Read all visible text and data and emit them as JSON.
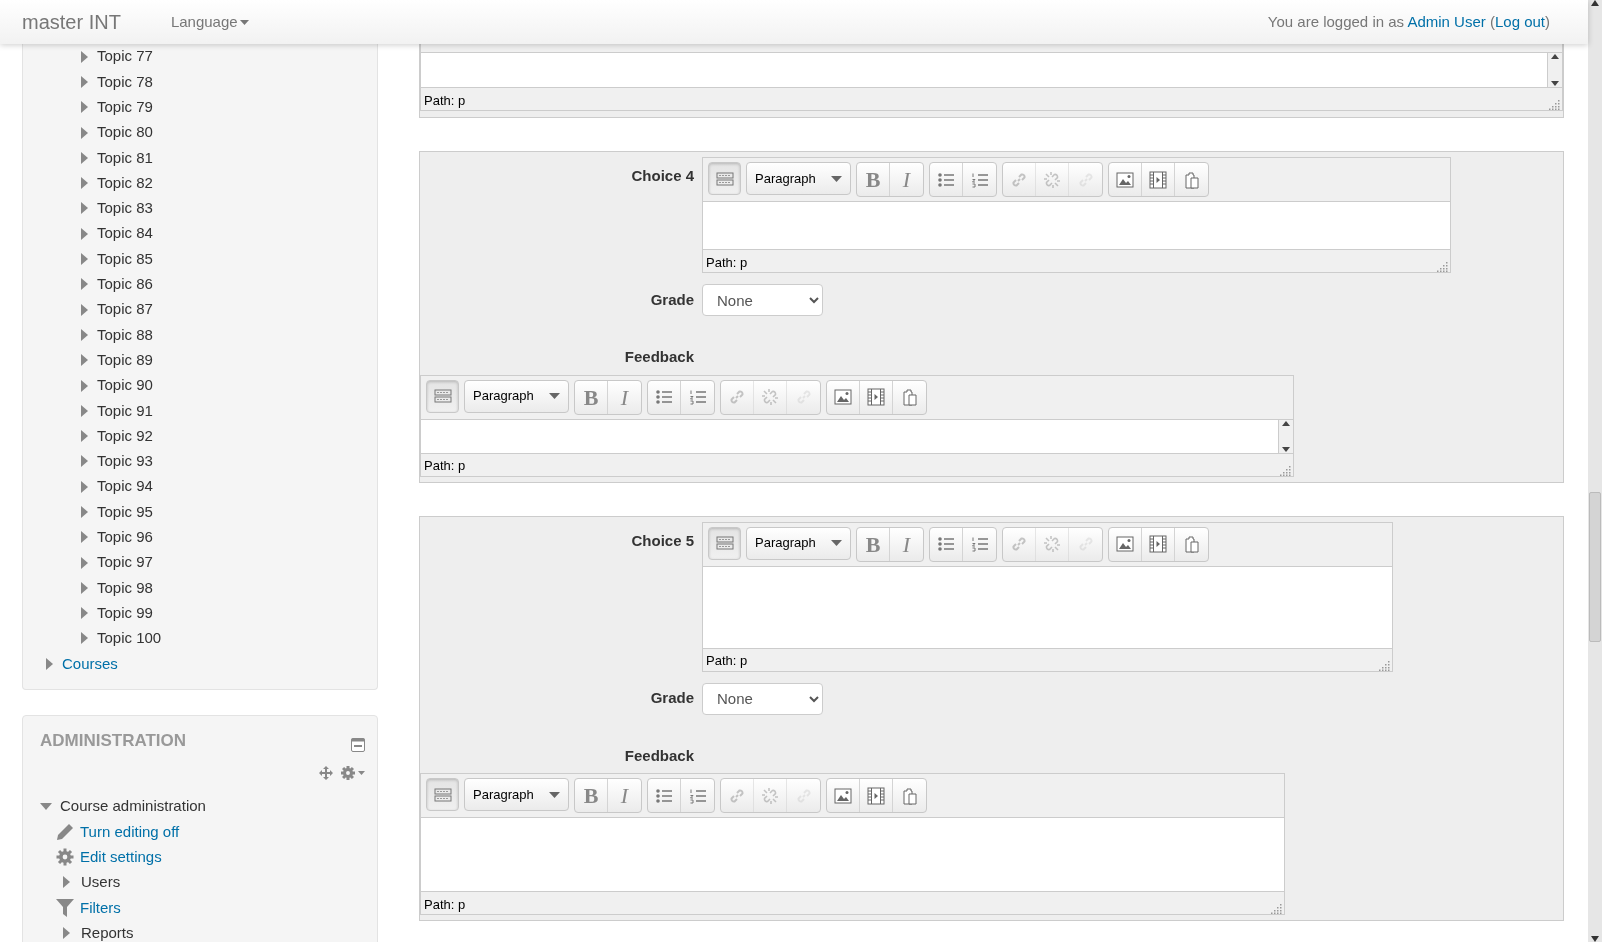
{
  "navbar": {
    "brand": "master INT",
    "language_menu": "Language",
    "login": {
      "text_before": "You are logged in as",
      "user": "Admin User",
      "text_open": "(",
      "logout": "Log out",
      "text_close": ")"
    }
  },
  "navigation": {
    "topics": [
      {
        "label": "Topic 77",
        "expanded": false
      },
      {
        "label": "Topic 78",
        "expanded": false
      },
      {
        "label": "Topic 79",
        "expanded": false
      },
      {
        "label": "Topic 80",
        "expanded": false
      },
      {
        "label": "Topic 81",
        "expanded": false
      },
      {
        "label": "Topic 82",
        "expanded": false
      },
      {
        "label": "Topic 83",
        "expanded": false
      },
      {
        "label": "Topic 84",
        "expanded": false
      },
      {
        "label": "Topic 85",
        "expanded": false
      },
      {
        "label": "Topic 86",
        "expanded": false
      },
      {
        "label": "Topic 87",
        "expanded": false
      },
      {
        "label": "Topic 88",
        "expanded": false
      },
      {
        "label": "Topic 89",
        "expanded": false
      },
      {
        "label": "Topic 90",
        "expanded": false
      },
      {
        "label": "Topic 91",
        "expanded": false
      },
      {
        "label": "Topic 92",
        "expanded": false
      },
      {
        "label": "Topic 93",
        "expanded": false
      },
      {
        "label": "Topic 94",
        "expanded": false
      },
      {
        "label": "Topic 95",
        "expanded": false
      },
      {
        "label": "Topic 96",
        "expanded": false
      },
      {
        "label": "Topic 97",
        "expanded": false
      },
      {
        "label": "Topic 98",
        "expanded": false
      },
      {
        "label": "Topic 99",
        "expanded": false
      },
      {
        "label": "Topic 100",
        "expanded": false
      }
    ],
    "courses": {
      "label": "Courses",
      "expanded": false
    }
  },
  "administration": {
    "title": "ADMINISTRATION",
    "items": [
      {
        "label": "Course administration",
        "kind": "branch",
        "expanded": true,
        "children": [
          {
            "label": "Turn editing off",
            "kind": "edit-link"
          },
          {
            "label": "Edit settings",
            "kind": "settings-link"
          },
          {
            "label": "Users",
            "kind": "branch",
            "expanded": false
          },
          {
            "label": "Filters",
            "kind": "filter-link"
          },
          {
            "label": "Reports",
            "kind": "branch",
            "expanded": false
          }
        ]
      }
    ]
  },
  "form": {
    "partial_editor": {
      "path": "Path: p",
      "scrollbar": true
    },
    "choices": [
      {
        "label": "Choice 4",
        "editor": {
          "format": "Paragraph",
          "bold": "B",
          "italic": "I",
          "links_disabled": true,
          "path": "Path: p",
          "scrollbar": false
        },
        "grade_label": "Grade",
        "grade": "None",
        "feedback_label": "Feedback",
        "feedback_editor": {
          "format": "Paragraph",
          "bold": "B",
          "italic": "I",
          "links_disabled": true,
          "path": "Path: p",
          "scrollbar": true
        }
      },
      {
        "label": "Choice 5",
        "editor": {
          "format": "Paragraph",
          "bold": "B",
          "italic": "I",
          "links_disabled": true,
          "path": "Path: p",
          "scrollbar": false
        },
        "grade_label": "Grade",
        "grade": "None",
        "feedback_label": "Feedback",
        "feedback_editor": {
          "format": "Paragraph",
          "bold": "B",
          "italic": "I",
          "links_disabled": true,
          "path": "Path: p",
          "scrollbar": false
        }
      }
    ]
  }
}
